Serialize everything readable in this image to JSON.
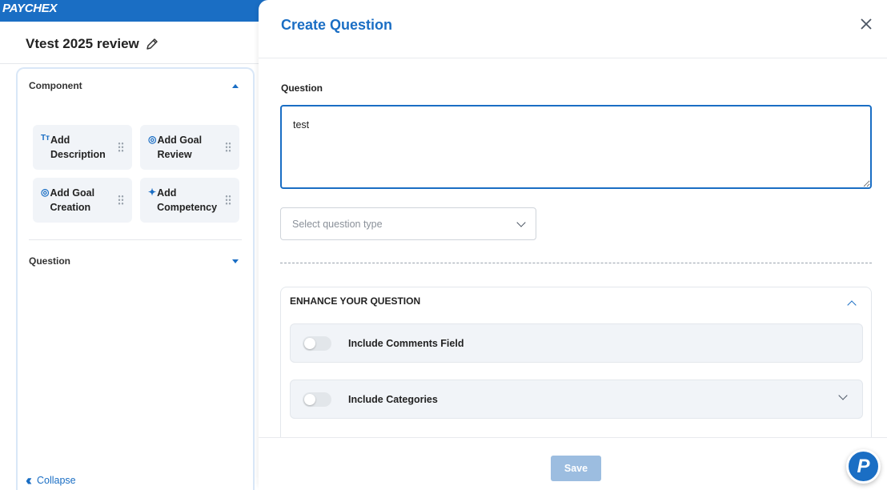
{
  "brand": {
    "logo": "PAYCHEX"
  },
  "page": {
    "title": "Vtest 2025 review"
  },
  "builder": {
    "component_section": "Component",
    "components": [
      {
        "icon": "Tт",
        "label": "Add\nDescription"
      },
      {
        "icon": "◎",
        "label": "Add Goal\nReview"
      },
      {
        "icon": "◎",
        "label": "Add Goal\nCreation"
      },
      {
        "icon": "✦",
        "label": "Add\nCompetency"
      }
    ],
    "question_section": "Question",
    "collapse_label": "Collapse"
  },
  "drawer": {
    "title": "Create Question",
    "question_label": "Question",
    "question_value": "test",
    "type_placeholder": "Select question type",
    "enhance_title": "ENHANCE YOUR QUESTION",
    "options": [
      {
        "label": "Include Comments Field",
        "enabled": false
      },
      {
        "label": "Include Categories",
        "enabled": false
      }
    ],
    "save_label": "Save"
  },
  "fab": {
    "label": "P"
  },
  "colors": {
    "accent": "#1a6ec4",
    "save_disabled": "#9cbde0"
  }
}
